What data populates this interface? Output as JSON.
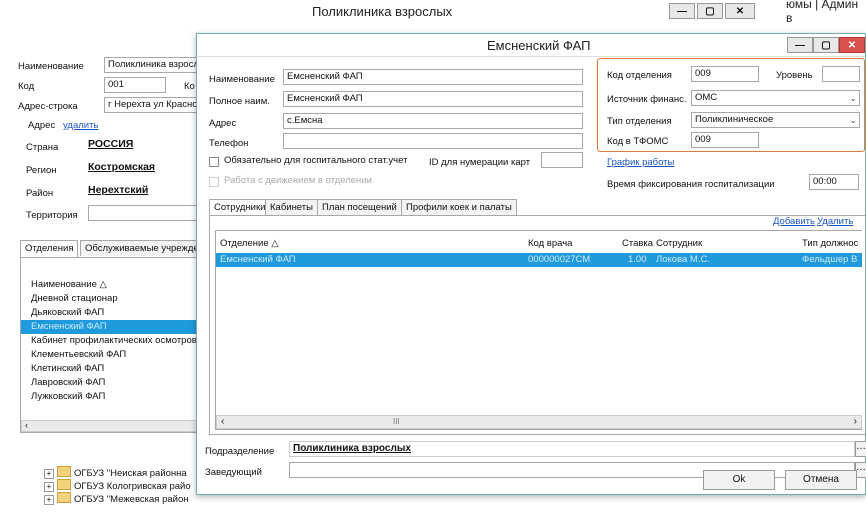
{
  "bg_window": {
    "title": "Поликлиника взрослых",
    "corner_text": "юмы | Админ в",
    "fields": [
      {
        "label": "Наименование",
        "value": "Поликлиника взросл"
      },
      {
        "label": "Код",
        "value": "001",
        "extra_label": "Ко"
      },
      {
        "label": "Адрес-строка",
        "value": "г Нерехта ул Красно"
      }
    ],
    "address_label": "Адрес",
    "address_delete": "удалить",
    "country_label": "Страна",
    "country_value": "РОССИЯ",
    "region_label": "Регион",
    "region_value": "Костромская",
    "district_label": "Район",
    "district_value": "Нерехтский",
    "territory_label": "Территория",
    "tabs": [
      "Отделения",
      "Обслуживаемые учрежде"
    ],
    "list_header": "Наименование",
    "list_items": [
      "Дневной стационар",
      "Дьяковский ФАП",
      "Емсненский ФАП",
      "Кабинет профилактических осмотров",
      "Клементьевский ФАП",
      "Клетинский ФАП",
      "Лавровский ФАП",
      "Лужковский ФАП"
    ],
    "selected_index": 2
  },
  "tree": {
    "items": [
      "ОГБУЗ \"Неиская районна",
      "ОГБУЗ Кологривская райо",
      "ОГБУЗ \"Межевская район"
    ]
  },
  "dialog": {
    "title": "Емсненский ФАП",
    "name_label": "Наименование",
    "name_value": "Емсненский ФАП",
    "fullname_label": "Полное наим.",
    "fullname_value": "Емсненский ФАП",
    "address_label": "Адрес",
    "address_value": "с.Емсна",
    "phone_label": "Телефон",
    "phone_value": "",
    "checkbox_stat": "Обязательно для госпитального стат.учет",
    "checkbox_flow": "Работа с движением в отделении",
    "card_id_label": "ID для нумерации карт",
    "card_id_value": "",
    "dept_code_label": "Код отделения",
    "dept_code_value": "009",
    "level_label": "Уровень",
    "level_value": "",
    "finance_label": "Источник финанс.",
    "finance_value": "ОМС",
    "dept_type_label": "Тип отделения",
    "dept_type_value": "Поликлиническое",
    "tfoms_label": "Код в ТФОМС",
    "tfoms_value": "009",
    "schedule_link": "График работы",
    "fixtime_label": "Время фиксирования госпитализации",
    "fixtime_value": "00:00",
    "tabs": [
      "Сотрудники",
      "Кабинеты",
      "План посещений",
      "Профили коек и палаты"
    ],
    "add_link": "Добавить",
    "delete_link": "Удалить",
    "grid_columns": [
      "Отделение",
      "Код врача",
      "Ставка",
      "Сотрудник",
      "Тип должнос"
    ],
    "grid_rows": [
      {
        "dept": "Емсненский ФАП",
        "code": "000000027СМ",
        "rate": "1.00",
        "employee": "Локова М.С.",
        "type": "Фельдшер В"
      }
    ],
    "scroll_mark": "III",
    "subdivision_label": "Подразделение",
    "subdivision_value": "Поликлиника взрослых",
    "head_label": "Заведующий",
    "head_value": "",
    "ok_label": "Ok",
    "cancel_label": "Отмена",
    "accent_color": "#e07a3a"
  }
}
